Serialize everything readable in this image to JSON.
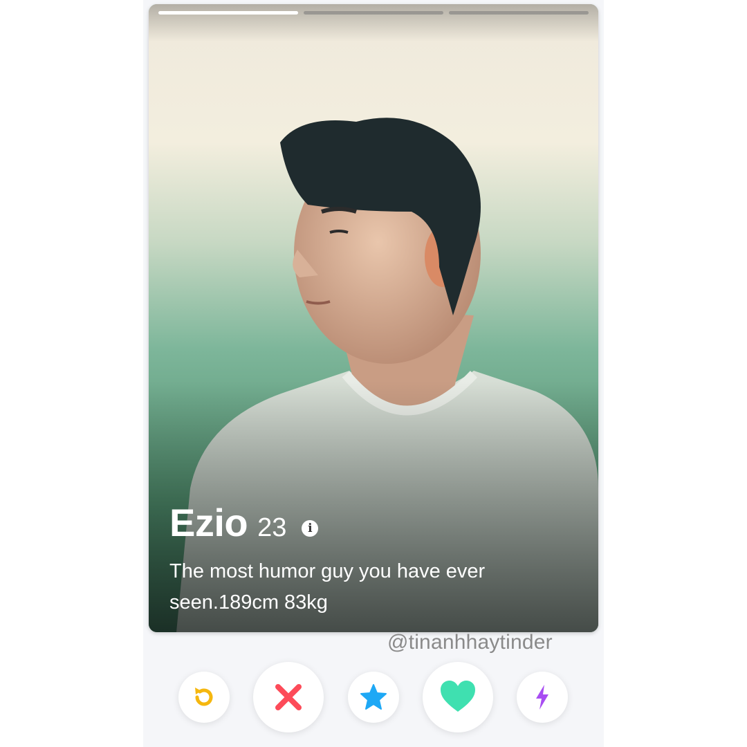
{
  "profile": {
    "name": "Ezio",
    "age": "23",
    "bio": "The most humor guy you have ever seen.189cm 83kg",
    "photo_count": 3,
    "current_photo": 1
  },
  "watermark": "@tinanhhaytinder",
  "actions": [
    {
      "id": "rewind",
      "icon": "rewind-icon",
      "color": "#f5b70f"
    },
    {
      "id": "nope",
      "icon": "close-icon",
      "color": "#fd4b59"
    },
    {
      "id": "super-like",
      "icon": "star-icon",
      "color": "#1ea8f5"
    },
    {
      "id": "like",
      "icon": "heart-icon",
      "color": "#3fe0b0"
    },
    {
      "id": "boost",
      "icon": "lightning-icon",
      "color": "#a84df2"
    }
  ],
  "colors": {
    "app_background": "#f5f6f9",
    "card_text": "#ffffff",
    "watermark": "#8a8a8a"
  }
}
